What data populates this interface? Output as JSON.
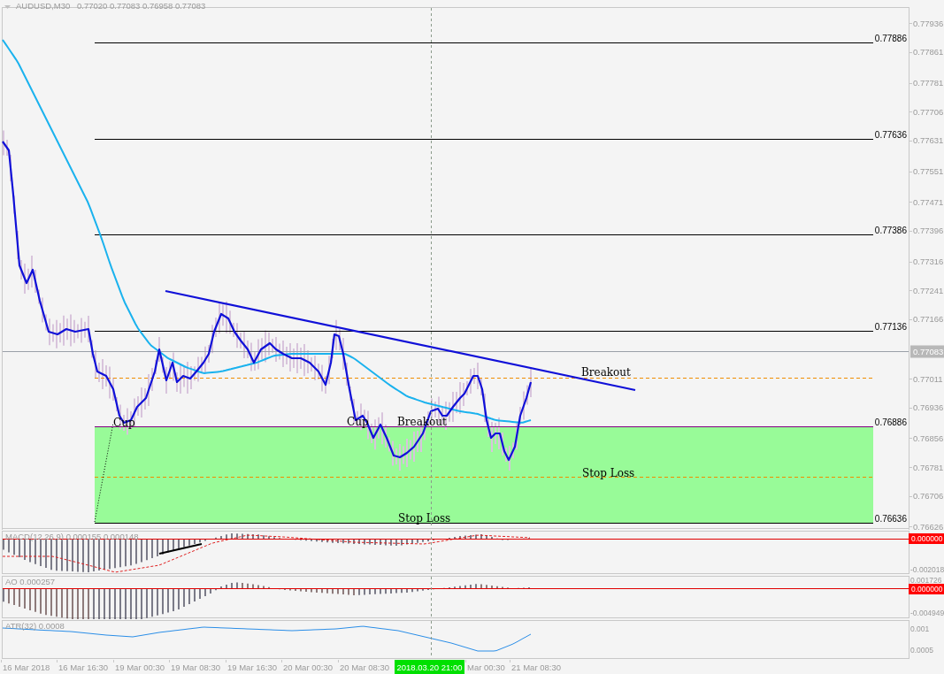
{
  "header": {
    "symbol": "AUDUSD,M30",
    "ohlc": "0.77020 0.77083 0.76958 0.77083"
  },
  "price_axis": {
    "ticks": [
      "0.77936",
      "0.77861",
      "0.77781",
      "0.77706",
      "0.77631",
      "0.77551",
      "0.77471",
      "0.77396",
      "0.77316",
      "0.77241",
      "0.77166",
      "0.77011",
      "0.76936",
      "0.76856",
      "0.76781",
      "0.76706",
      "0.76626"
    ],
    "current": "0.77083"
  },
  "levels": [
    {
      "label": "0.77886",
      "kind": "line"
    },
    {
      "label": "0.77636",
      "kind": "line"
    },
    {
      "label": "0.77386",
      "kind": "line"
    },
    {
      "label": "0.77136",
      "kind": "line"
    },
    {
      "label": "0.76886",
      "kind": "zone_top"
    },
    {
      "label": "0.76636",
      "kind": "zone_bottom"
    }
  ],
  "annotations": [
    {
      "text": "Cup"
    },
    {
      "text": "Cup"
    },
    {
      "text": "Breakout"
    },
    {
      "text": "Breakout"
    },
    {
      "text": "Stop Loss"
    },
    {
      "text": "Stop Loss"
    }
  ],
  "indicators": [
    {
      "kind": "macd",
      "label": "MACD(12,26,9) 0.000155 0.000148",
      "axis_labels": [
        {
          "text": "0.000000",
          "kind": "badge"
        },
        {
          "text": "-0.002018",
          "kind": "tick"
        }
      ]
    },
    {
      "kind": "ao",
      "label": "AO 0.000257",
      "axis_labels": [
        {
          "text": "0.001726",
          "kind": "tick"
        },
        {
          "text": "0.000000",
          "kind": "badge"
        },
        {
          "text": "-0.004949",
          "kind": "tick"
        }
      ]
    },
    {
      "kind": "atr",
      "label": "ATR(32) 0.0008",
      "axis_labels": [
        {
          "text": "0.001",
          "kind": "tick"
        },
        {
          "text": "0.0005",
          "kind": "tick"
        }
      ]
    }
  ],
  "time_axis": {
    "labels": [
      "16 Mar 2018",
      "16 Mar 16:30",
      "19 Mar 00:30",
      "19 Mar 08:30",
      "19 Mar 16:30",
      "20 Mar 00:30",
      "20 Mar 08:30",
      "Mar 00:30",
      "21 Mar 08:30"
    ],
    "crosshair": "2018.03.20 21:00"
  }
}
